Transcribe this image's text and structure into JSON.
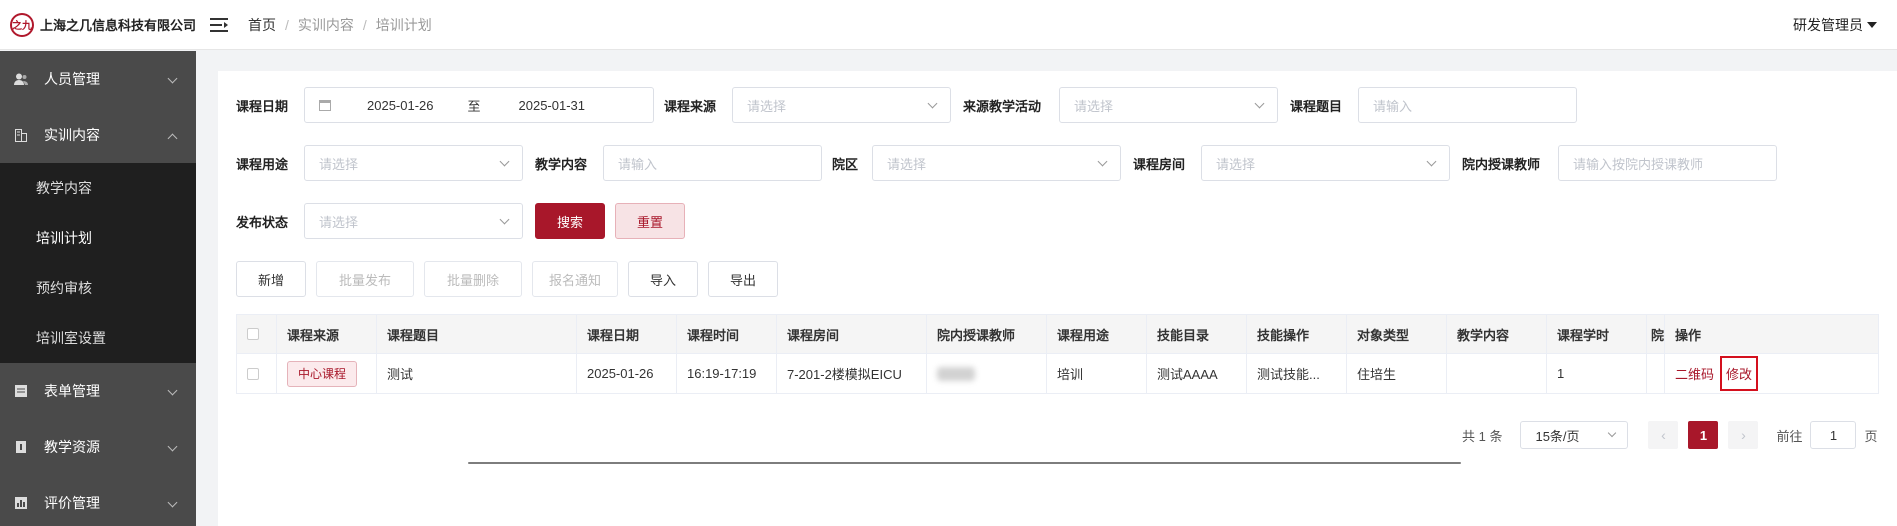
{
  "header": {
    "logo_mark": "之九",
    "company": "上海之几信息科技有限公司",
    "breadcrumb": [
      "首页",
      "实训内容",
      "培训计划"
    ],
    "user": "研发管理员"
  },
  "sidebar": {
    "groups": [
      {
        "label": "人员管理",
        "icon": "users-icon"
      },
      {
        "label": "实训内容",
        "icon": "content-icon"
      },
      {
        "label": "表单管理",
        "icon": "form-icon"
      },
      {
        "label": "教学资源",
        "icon": "resource-icon"
      },
      {
        "label": "评价管理",
        "icon": "evaluation-icon"
      }
    ],
    "sub_items": [
      "教学内容",
      "培训计划",
      "预约审核",
      "培训室设置"
    ]
  },
  "filters": {
    "course_date_label": "课程日期",
    "date_start": "2025-01-26",
    "date_to": "至",
    "date_end": "2025-01-31",
    "course_source_label": "课程来源",
    "course_source_placeholder": "请选择",
    "teaching_activity_label": "来源教学活动",
    "teaching_activity_placeholder": "请选择",
    "course_topic_label": "课程题目",
    "course_topic_placeholder": "请输入",
    "course_use_label": "课程用途",
    "course_use_placeholder": "请选择",
    "teaching_content_label": "教学内容",
    "teaching_content_placeholder": "请输入",
    "campus_label": "院区",
    "campus_placeholder": "请选择",
    "room_label": "课程房间",
    "room_placeholder": "请选择",
    "teacher_label": "院内授课教师",
    "teacher_placeholder": "请输入按院内授课教师",
    "status_label": "发布状态",
    "status_placeholder": "请选择",
    "search_button": "搜索",
    "reset_button": "重置"
  },
  "toolbar": {
    "add": "新增",
    "batch_publish": "批量发布",
    "batch_delete": "批量删除",
    "signup_notice": "报名通知",
    "import": "导入",
    "export": "导出"
  },
  "table": {
    "columns": [
      "课程来源",
      "课程题目",
      "课程日期",
      "课程时间",
      "课程房间",
      "院内授课教师",
      "课程用途",
      "技能目录",
      "技能操作",
      "对象类型",
      "教学内容",
      "课程学时",
      "院",
      "操作"
    ],
    "rows": [
      {
        "source": "中心课程",
        "topic": "测试",
        "date": "2025-01-26",
        "time": "16:19-17:19",
        "room": "7-201-2楼模拟EICU",
        "teacher": "",
        "use": "培训",
        "skill_dir": "测试AAAA",
        "skill_op": "测试技能...",
        "target": "住培生",
        "content": "",
        "hours": "1",
        "campus": "",
        "action_qr": "二维码",
        "action_edit": "修改"
      }
    ]
  },
  "pagination": {
    "total": "共 1 条",
    "page_size": "15条/页",
    "prev": "‹",
    "current": "1",
    "next": "›",
    "goto_label": "前往",
    "goto_value": "1",
    "page_suffix": "页"
  },
  "colors": {
    "brand": "#a8172a",
    "sidebar_bg": "#4a4a4a",
    "submenu_bg": "#1f1f1f",
    "highlight": "#d4101e"
  }
}
